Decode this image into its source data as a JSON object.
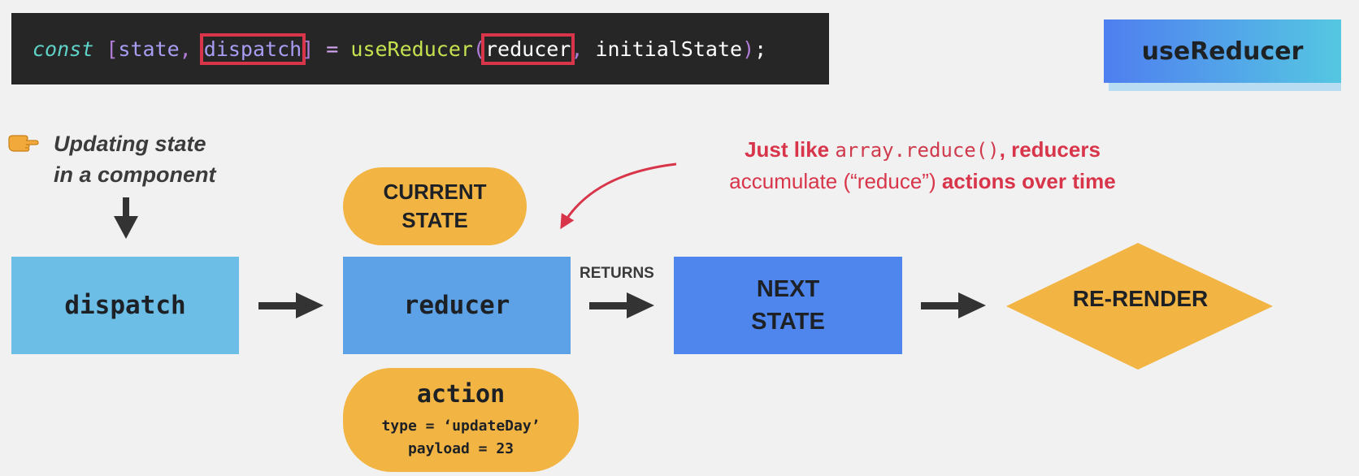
{
  "code": {
    "kw": "const",
    "open_bracket": "[",
    "state": "state",
    "comma1": ", ",
    "dispatch": "dispatch",
    "close_bracket": "]",
    "equals": " = ",
    "fn": "useReducer",
    "open_paren": "(",
    "reducer_arg": "reducer",
    "comma2": ", ",
    "initial_arg": "initialState",
    "close_paren": ")",
    "semi": ";"
  },
  "badge": {
    "label": "useReducer"
  },
  "note": {
    "line1": "Updating state",
    "line2": "in a component",
    "icon": "pointing-hand-icon"
  },
  "red_note": {
    "part1": "Just like ",
    "code": "array.reduce()",
    "part2": ", reducers",
    "part3": "accumulate (“reduce”) ",
    "emph": "actions over time"
  },
  "boxes": {
    "dispatch": "dispatch",
    "reducer": "reducer",
    "next_line1": "NEXT",
    "next_line2": "STATE",
    "current_line1": "CURRENT",
    "current_line2": "STATE",
    "returns": "RETURNS",
    "rerender": "RE-RENDER"
  },
  "action": {
    "title": "action",
    "type_line": "type = ‘updateDay’",
    "payload_line": "payload = 23"
  },
  "colors": {
    "red": "#d8354a",
    "orange": "#f2b442",
    "arrow": "#333333",
    "blue_light": "#6cbee6",
    "blue_mid": "#5da2e6",
    "blue_dark": "#4f86ee"
  }
}
